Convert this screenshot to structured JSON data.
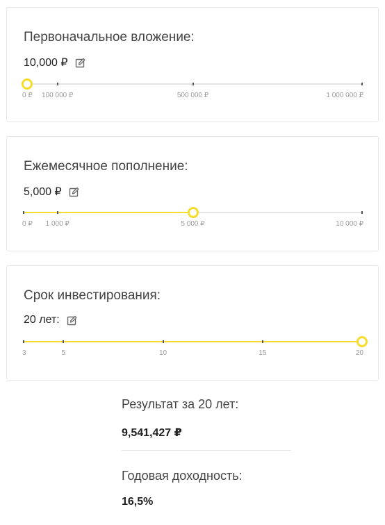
{
  "initial": {
    "title": "Первоначальное вложение:",
    "value": "10,000 ₽",
    "fraction": 0.01,
    "ticks": [
      0,
      0.1,
      0.5,
      1.0
    ],
    "labels": [
      "0 ₽",
      "100 000 ₽",
      "500 000 ₽",
      "1 000 000 ₽"
    ]
  },
  "monthly": {
    "title": "Ежемесячное пополнение:",
    "value": "5,000 ₽",
    "fraction": 0.5,
    "ticks": [
      0,
      0.1,
      0.5,
      1.0
    ],
    "labels": [
      "0 ₽",
      "1 000 ₽",
      "5 000 ₽",
      "10 000 ₽"
    ]
  },
  "term": {
    "title": "Срок инвестирования:",
    "value": "20 лет:",
    "fraction": 1.0,
    "ticks": [
      0,
      0.1176,
      0.4118,
      0.7059,
      1.0
    ],
    "labels": [
      "3",
      "5",
      "10",
      "15",
      "20"
    ]
  },
  "result": {
    "label": "Результат за 20 лет:",
    "value": "9,541,427 ₽",
    "yield_label": "Годовая доходность:",
    "yield_value": "16,5%"
  },
  "colors": {
    "accent": "#f5dc2d",
    "track": "#e4e4e4"
  },
  "icons": {
    "edit": "pencil-edit-icon"
  }
}
